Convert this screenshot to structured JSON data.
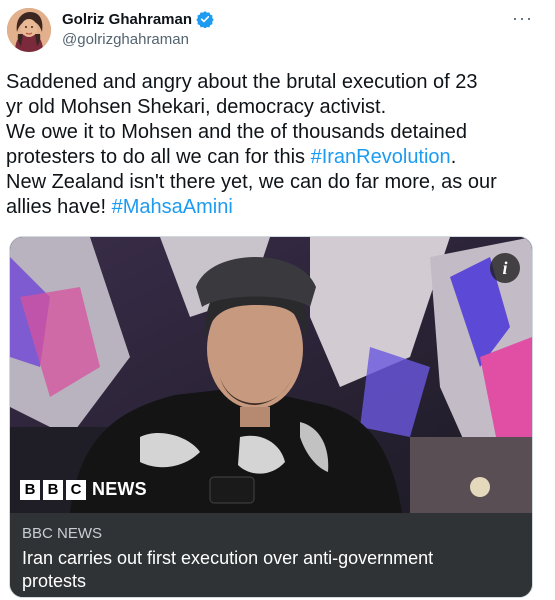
{
  "author": {
    "name": "Golriz Ghahraman",
    "handle": "@golrizghahraman",
    "verified": true
  },
  "tweet": {
    "lines": [
      [
        {
          "t": "Saddened and angry about the brutal execution of 23"
        }
      ],
      [
        {
          "t": "yr old Mohsen Shekari, democracy activist."
        }
      ],
      [
        {
          "t": "We owe it to Mohsen and the of thousands detained"
        }
      ],
      [
        {
          "t": "protesters to do all we can for this "
        },
        {
          "t": "#IranRevolution",
          "tag": true
        },
        {
          "t": "."
        }
      ],
      [
        {
          "t": "New Zealand isn't there yet, we can do far more, as our"
        }
      ],
      [
        {
          "t": "allies have! "
        },
        {
          "t": "#MahsaAmini",
          "tag": true
        }
      ]
    ]
  },
  "card": {
    "logo_letters": [
      "B",
      "B",
      "C"
    ],
    "logo_word": "NEWS",
    "source": "BBC NEWS",
    "title_lines": [
      "Iran carries out first execution over anti-government",
      "protests"
    ],
    "info_badge": "i"
  },
  "icons": {
    "more": "more-horizontal-icon",
    "verified": "verified-badge-icon",
    "info": "info-icon"
  },
  "colors": {
    "link": "#1d9bf0",
    "verified": "#1d9bf0",
    "card_footer": "#2f3336"
  }
}
